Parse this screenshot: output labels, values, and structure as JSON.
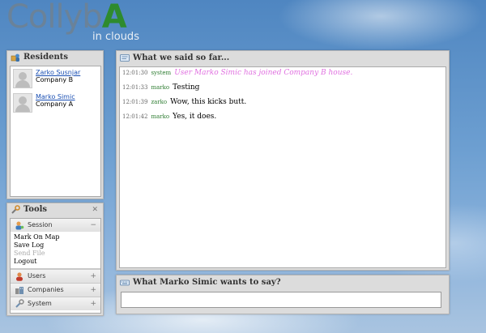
{
  "logo": {
    "main": "Collyb",
    "accent": "A",
    "sub": "in clouds"
  },
  "residents": {
    "title": "Residents",
    "items": [
      {
        "name": "Zarko Susnjar",
        "company": "Company B"
      },
      {
        "name": "Marko Simic",
        "company": "Company A"
      }
    ]
  },
  "tools": {
    "title": "Tools",
    "close": "✕",
    "session": {
      "label": "Session",
      "toggle": "−",
      "links": [
        {
          "label": "Mark On Map",
          "enabled": true
        },
        {
          "label": "Save Log",
          "enabled": true
        },
        {
          "label": "Send File",
          "enabled": false
        },
        {
          "label": "Logout",
          "enabled": true
        }
      ]
    },
    "sections": [
      {
        "label": "Users",
        "toggle": "+"
      },
      {
        "label": "Companies",
        "toggle": "+"
      },
      {
        "label": "System",
        "toggle": "+"
      }
    ]
  },
  "chat": {
    "title": "What we said so far...",
    "messages": [
      {
        "time": "12:01:30",
        "user": "system",
        "text": "User Marko Simic has joined Company B house.",
        "system": true
      },
      {
        "time": "12:01:33",
        "user": "marko",
        "text": "Testing",
        "system": false
      },
      {
        "time": "12:01:39",
        "user": "zarko",
        "text": "Wow, this kicks butt.",
        "system": false
      },
      {
        "time": "12:01:42",
        "user": "marko",
        "text": "Yes, it does.",
        "system": false
      }
    ]
  },
  "input": {
    "title": "What Marko Simic wants to say?",
    "value": ""
  },
  "colors": {
    "accent": "#2e8b2e",
    "link": "#1a4fb3",
    "system_text": "#e070e0",
    "username": "#2e7d32"
  }
}
